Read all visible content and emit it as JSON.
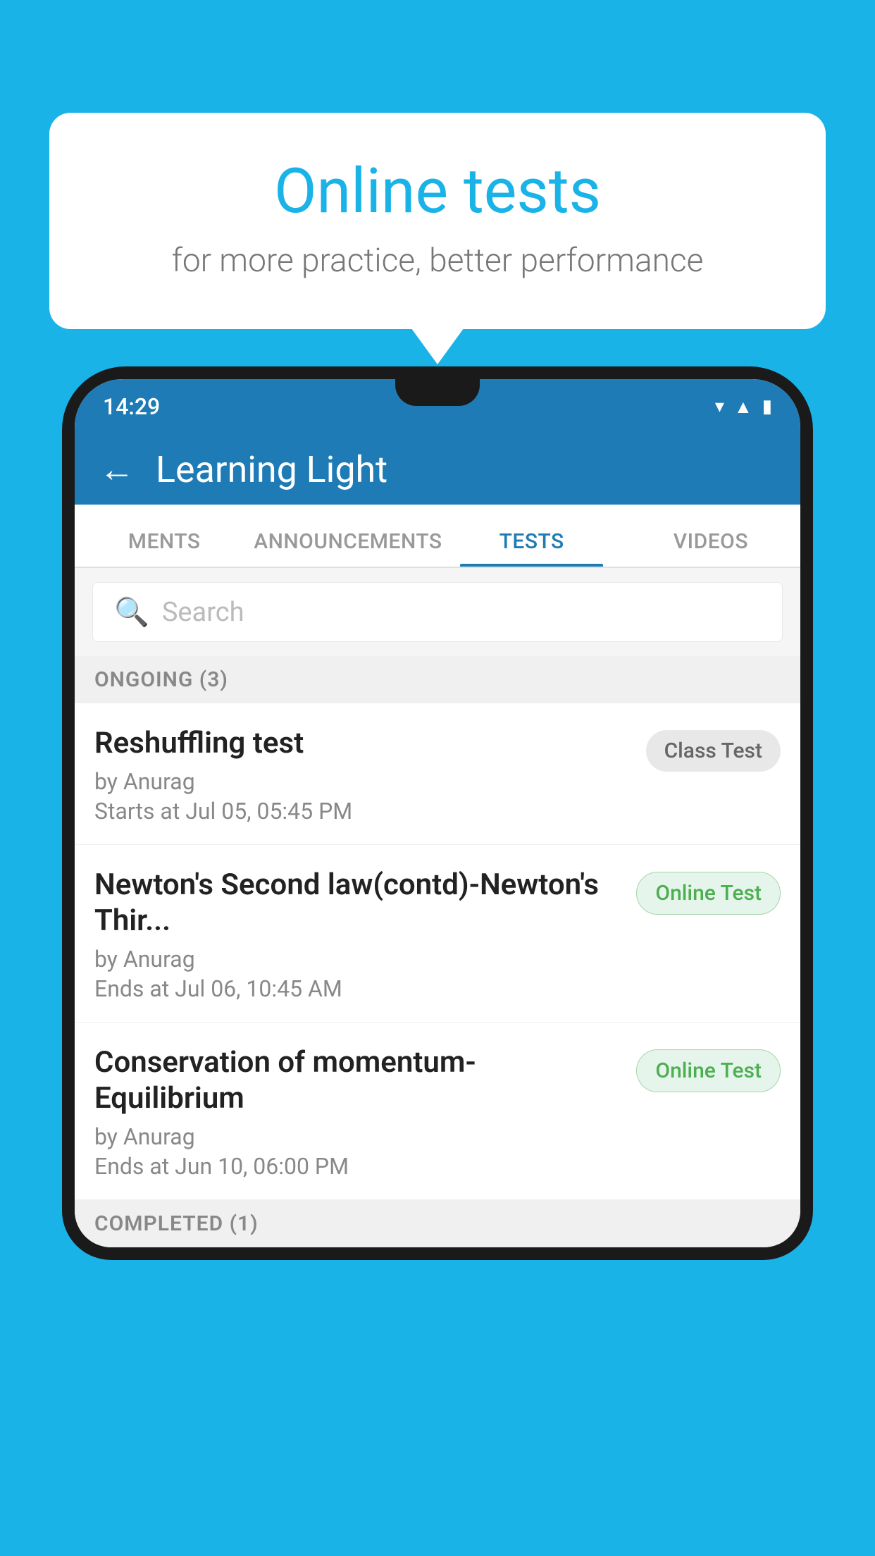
{
  "background_color": "#1ab3e8",
  "speech_bubble": {
    "title": "Online tests",
    "subtitle": "for more practice, better performance"
  },
  "phone": {
    "status_bar": {
      "time": "14:29",
      "icons": [
        "wifi",
        "signal",
        "battery"
      ]
    },
    "header": {
      "back_label": "←",
      "title": "Learning Light"
    },
    "tabs": [
      {
        "label": "MENTS",
        "active": false
      },
      {
        "label": "ANNOUNCEMENTS",
        "active": false
      },
      {
        "label": "TESTS",
        "active": true
      },
      {
        "label": "VIDEOS",
        "active": false
      }
    ],
    "search": {
      "placeholder": "Search"
    },
    "ongoing_section": {
      "label": "ONGOING (3)",
      "items": [
        {
          "title": "Reshuffling test",
          "author": "by Anurag",
          "time": "Starts at  Jul 05, 05:45 PM",
          "badge": "Class Test",
          "badge_type": "class"
        },
        {
          "title": "Newton's Second law(contd)-Newton's Thir...",
          "author": "by Anurag",
          "time": "Ends at  Jul 06, 10:45 AM",
          "badge": "Online Test",
          "badge_type": "online"
        },
        {
          "title": "Conservation of momentum-Equilibrium",
          "author": "by Anurag",
          "time": "Ends at  Jun 10, 06:00 PM",
          "badge": "Online Test",
          "badge_type": "online"
        }
      ]
    },
    "completed_section": {
      "label": "COMPLETED (1)"
    }
  }
}
